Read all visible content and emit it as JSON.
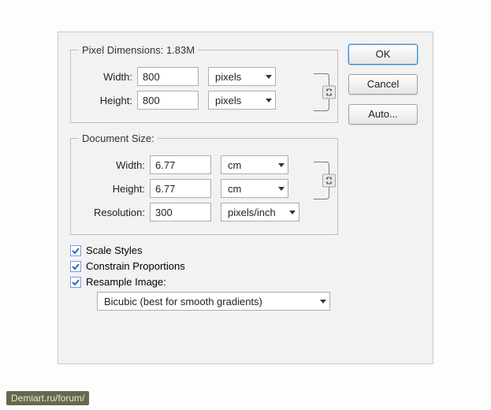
{
  "buttons": {
    "ok": "OK",
    "cancel": "Cancel",
    "auto": "Auto..."
  },
  "pixel_dimensions": {
    "legend_prefix": "Pixel Dimensions:",
    "size": "1.83M",
    "width_label": "Width:",
    "width_value": "800",
    "width_unit": "pixels",
    "height_label": "Height:",
    "height_value": "800",
    "height_unit": "pixels"
  },
  "document_size": {
    "legend": "Document Size:",
    "width_label": "Width:",
    "width_value": "6.77",
    "width_unit": "cm",
    "height_label": "Height:",
    "height_value": "6.77",
    "height_unit": "cm",
    "resolution_label": "Resolution:",
    "resolution_value": "300",
    "resolution_unit": "pixels/inch"
  },
  "checkboxes": {
    "scale_styles": "Scale Styles",
    "constrain_proportions": "Constrain Proportions",
    "resample_image": "Resample Image:"
  },
  "resample_method": "Bicubic (best for smooth gradients)",
  "watermark": "Demiart.ru/forum/"
}
